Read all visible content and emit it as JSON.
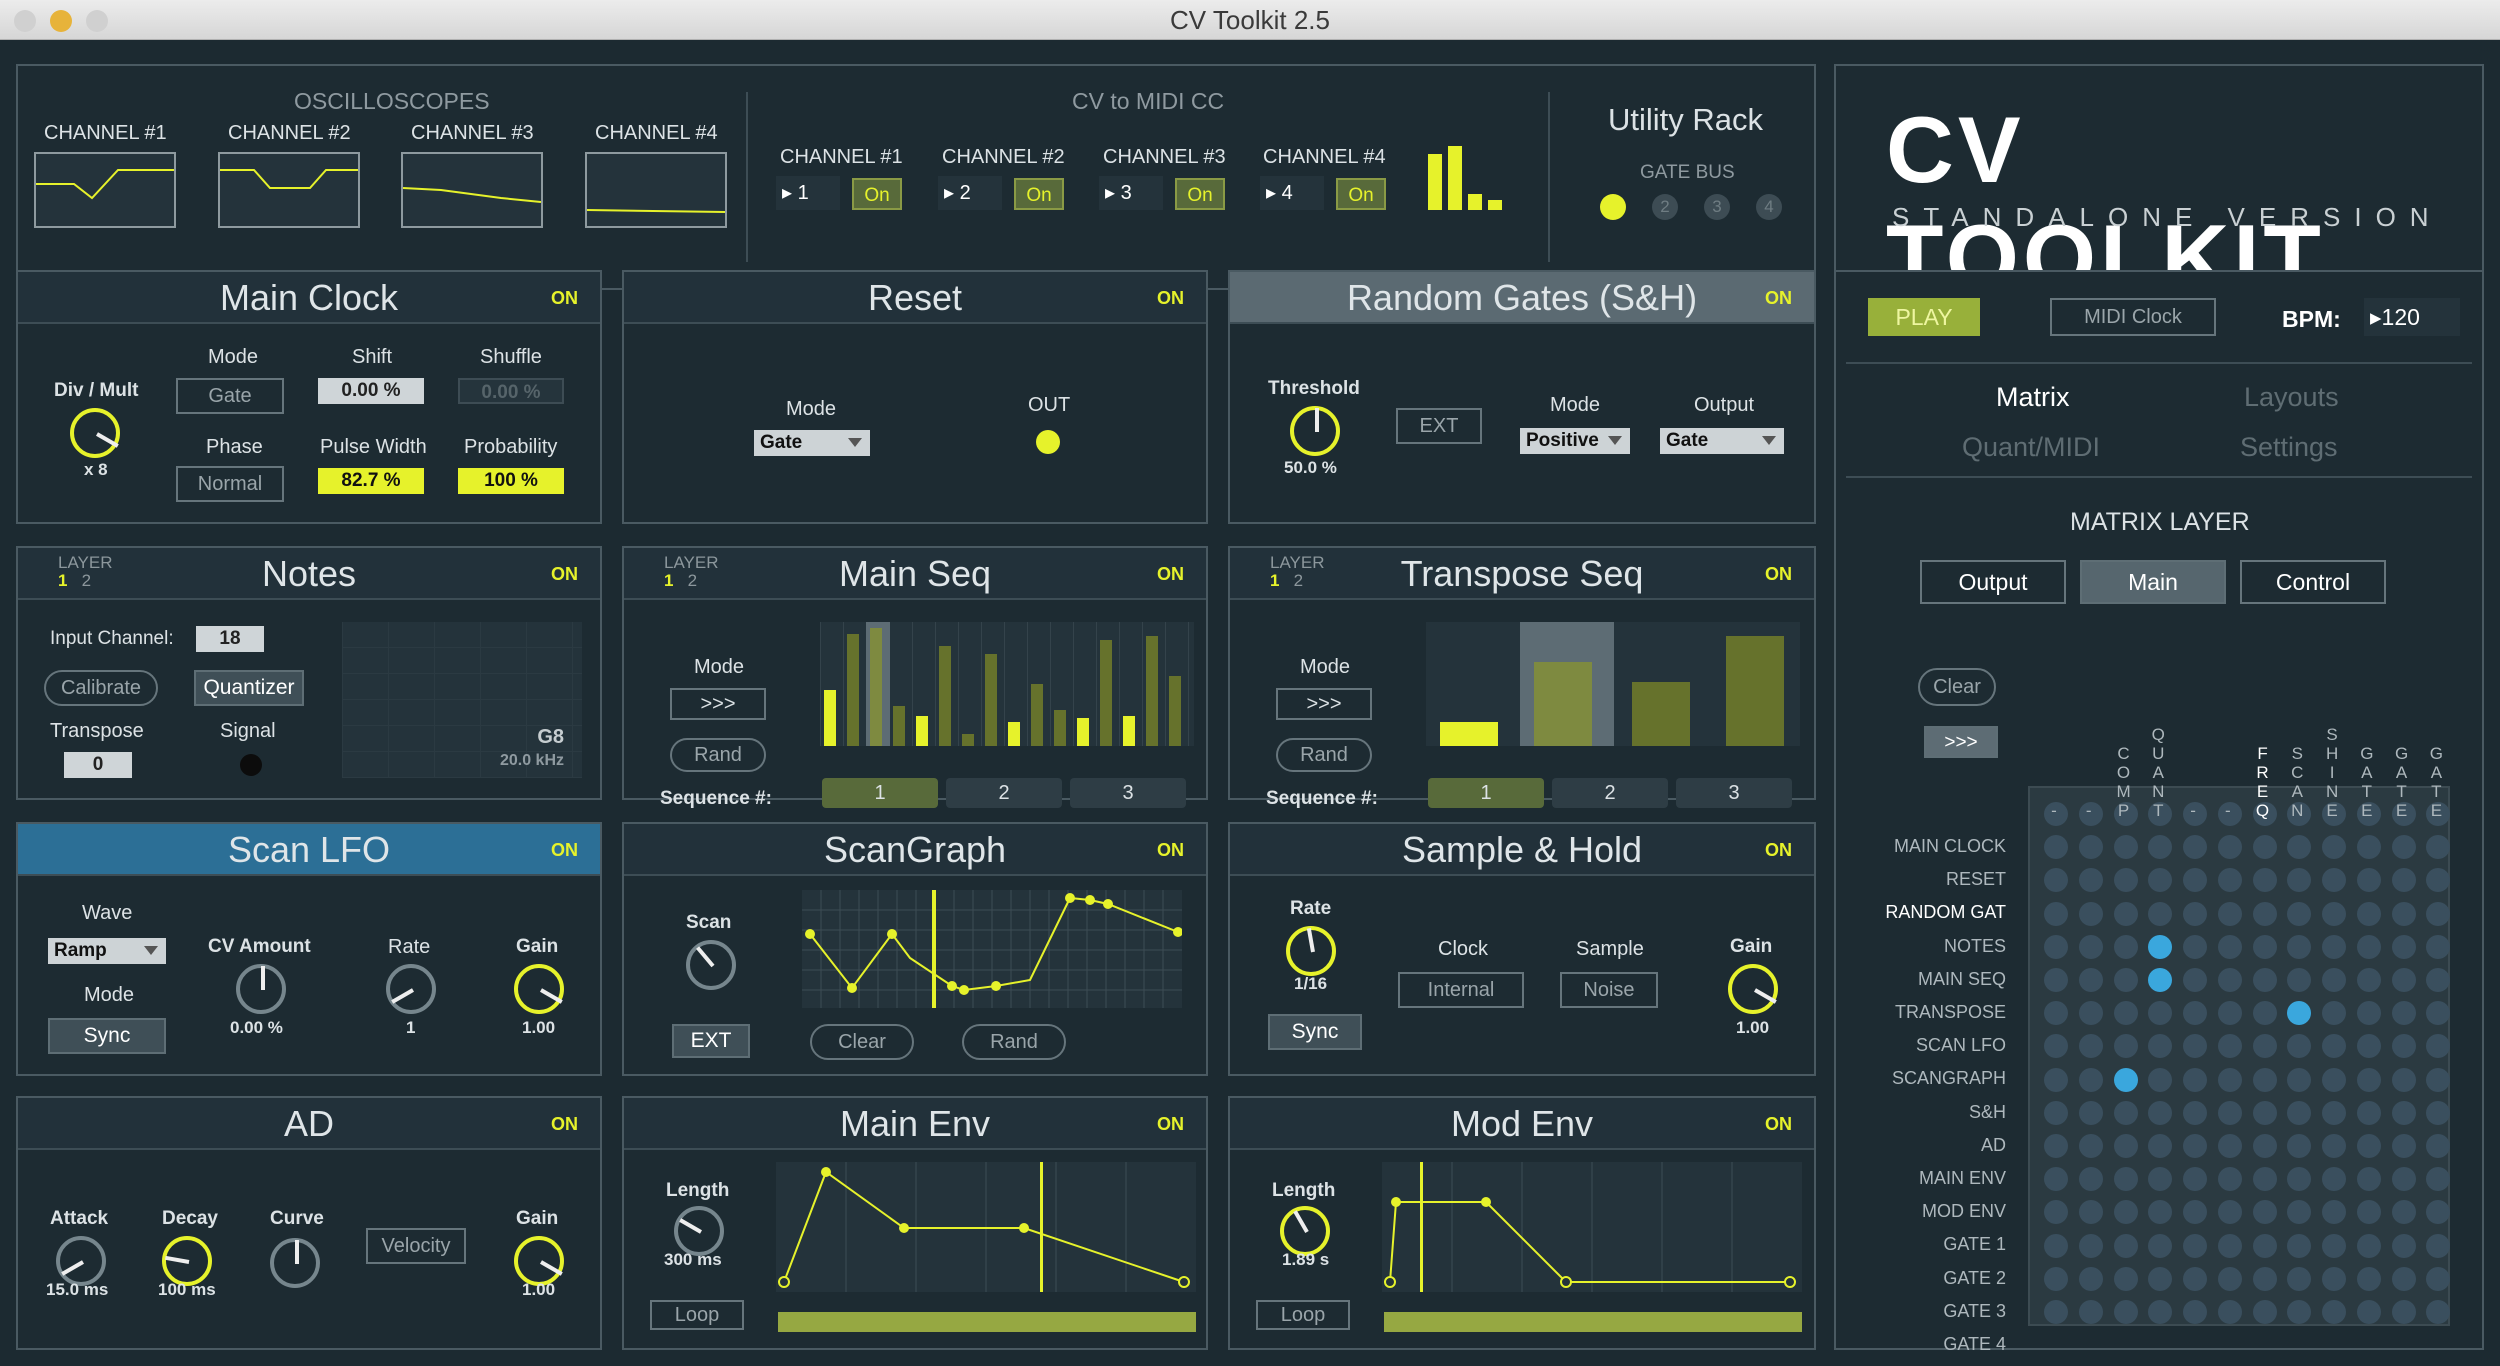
{
  "window": {
    "title": "CV Toolkit 2.5"
  },
  "scopes": {
    "title": "OSCILLOSCOPES",
    "channels": [
      "CHANNEL #1",
      "CHANNEL #2",
      "CHANNEL #3",
      "CHANNEL #4"
    ]
  },
  "cvmidi": {
    "title": "CV to MIDI CC",
    "channels": [
      {
        "label": "CHANNEL #1",
        "num": "1",
        "state": "On"
      },
      {
        "label": "CHANNEL #2",
        "num": "2",
        "state": "On"
      },
      {
        "label": "CHANNEL #3",
        "num": "3",
        "state": "On"
      },
      {
        "label": "CHANNEL #4",
        "num": "4",
        "state": "On"
      }
    ]
  },
  "utility": {
    "title": "Utility Rack",
    "gatebus": "GATE BUS",
    "gates": [
      "1",
      "2",
      "3",
      "4"
    ]
  },
  "logo": {
    "title": "CV TOOLKIT",
    "subtitle": "STANDALONE VERSION"
  },
  "on": "ON",
  "layer": {
    "label": "LAYER",
    "one": "1",
    "two": "2"
  },
  "mainclock": {
    "title": "Main Clock",
    "divmult": "Div / Mult",
    "divval": "x 8",
    "mode": "Mode",
    "modeval": "Gate",
    "shift": "Shift",
    "shiftval": "0.00 %",
    "shuffle": "Shuffle",
    "shuffleval": "0.00 %",
    "phase": "Phase",
    "phaseval": "Normal",
    "pw": "Pulse Width",
    "pwval": "82.7 %",
    "prob": "Probability",
    "probval": "100 %"
  },
  "reset": {
    "title": "Reset",
    "mode": "Mode",
    "modeval": "Gate",
    "out": "OUT"
  },
  "randgates": {
    "title": "Random Gates (S&H)",
    "threshold": "Threshold",
    "thval": "50.0 %",
    "ext": "EXT",
    "mode": "Mode",
    "modeval": "Positive",
    "output": "Output",
    "outval": "Gate"
  },
  "notes": {
    "title": "Notes",
    "inputch": "Input Channel:",
    "inputval": "18",
    "calibrate": "Calibrate",
    "quantizer": "Quantizer",
    "transpose": "Transpose",
    "transval": "0",
    "signal": "Signal",
    "note": "G8",
    "freq": "20.0 kHz"
  },
  "mainseq": {
    "title": "Main Seq",
    "mode": "Mode",
    "modeval": ">>>",
    "rand": "Rand",
    "seq": "Sequence #:",
    "steps": [
      "1",
      "2",
      "3"
    ]
  },
  "transseq": {
    "title": "Transpose Seq",
    "mode": "Mode",
    "modeval": ">>>",
    "rand": "Rand",
    "seq": "Sequence #:",
    "steps": [
      "1",
      "2",
      "3"
    ]
  },
  "scanlfo": {
    "title": "Scan LFO",
    "wave": "Wave",
    "waveval": "Ramp",
    "mode": "Mode",
    "sync": "Sync",
    "cvamt": "CV Amount",
    "cvval": "0.00 %",
    "rate": "Rate",
    "rateval": "1",
    "gain": "Gain",
    "gainval": "1.00"
  },
  "scangraph": {
    "title": "ScanGraph",
    "scan": "Scan",
    "ext": "EXT",
    "clear": "Clear",
    "rand": "Rand"
  },
  "sh": {
    "title": "Sample & Hold",
    "rate": "Rate",
    "rateval": "1/16",
    "sync": "Sync",
    "clock": "Clock",
    "clockval": "Internal",
    "sample": "Sample",
    "sampleval": "Noise",
    "gain": "Gain",
    "gainval": "1.00"
  },
  "ad": {
    "title": "AD",
    "attack": "Attack",
    "attval": "15.0 ms",
    "decay": "Decay",
    "decval": "100 ms",
    "curve": "Curve",
    "velocity": "Velocity",
    "gain": "Gain",
    "gainval": "1.00"
  },
  "mainenv": {
    "title": "Main Env",
    "length": "Length",
    "lenval": "300 ms",
    "loop": "Loop"
  },
  "modenv": {
    "title": "Mod Env",
    "length": "Length",
    "lenval": "1.89 s",
    "loop": "Loop"
  },
  "transport": {
    "play": "PLAY",
    "midiclock": "MIDI Clock",
    "bpm": "BPM:",
    "bpmval": "120"
  },
  "tabs": {
    "matrix": "Matrix",
    "layouts": "Layouts",
    "quant": "Quant/MIDI",
    "settings": "Settings"
  },
  "matrix": {
    "title": "MATRIX LAYER",
    "output": "Output",
    "main": "Main",
    "control": "Control",
    "clear": "Clear",
    "arrow": ">>>",
    "rows": [
      "MAIN CLOCK",
      "RESET",
      "RANDOM GAT",
      "NOTES",
      "MAIN SEQ",
      "TRANSPOSE",
      "SCAN LFO",
      "SCANGRAPH",
      "S&H",
      "AD",
      "MAIN ENV",
      "MOD ENV",
      "GATE 1",
      "GATE 2",
      "GATE 3",
      "GATE 4"
    ],
    "cols": [
      "-",
      "-",
      "COMP",
      "QUANT",
      "-",
      "-",
      "FREQ",
      "SCAN",
      "SHINE",
      "GATE",
      "GATE",
      "GATE"
    ]
  },
  "colors": {
    "accent": "#e6f22b",
    "matrix_on": "#3aa7dd",
    "bg": "#1c2a31"
  }
}
